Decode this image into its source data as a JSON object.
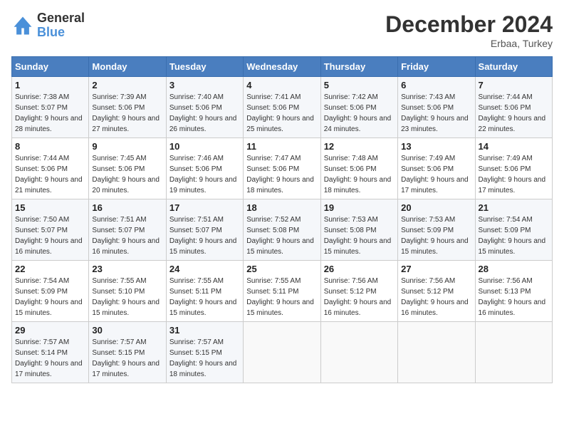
{
  "header": {
    "logo": {
      "line1": "General",
      "line2": "Blue"
    },
    "month": "December 2024",
    "location": "Erbaa, Turkey"
  },
  "weekdays": [
    "Sunday",
    "Monday",
    "Tuesday",
    "Wednesday",
    "Thursday",
    "Friday",
    "Saturday"
  ],
  "weeks": [
    [
      {
        "day": 1,
        "sunrise": "7:38 AM",
        "sunset": "5:07 PM",
        "daylight": "9 hours and 28 minutes."
      },
      {
        "day": 2,
        "sunrise": "7:39 AM",
        "sunset": "5:06 PM",
        "daylight": "9 hours and 27 minutes."
      },
      {
        "day": 3,
        "sunrise": "7:40 AM",
        "sunset": "5:06 PM",
        "daylight": "9 hours and 26 minutes."
      },
      {
        "day": 4,
        "sunrise": "7:41 AM",
        "sunset": "5:06 PM",
        "daylight": "9 hours and 25 minutes."
      },
      {
        "day": 5,
        "sunrise": "7:42 AM",
        "sunset": "5:06 PM",
        "daylight": "9 hours and 24 minutes."
      },
      {
        "day": 6,
        "sunrise": "7:43 AM",
        "sunset": "5:06 PM",
        "daylight": "9 hours and 23 minutes."
      },
      {
        "day": 7,
        "sunrise": "7:44 AM",
        "sunset": "5:06 PM",
        "daylight": "9 hours and 22 minutes."
      }
    ],
    [
      {
        "day": 8,
        "sunrise": "7:44 AM",
        "sunset": "5:06 PM",
        "daylight": "9 hours and 21 minutes."
      },
      {
        "day": 9,
        "sunrise": "7:45 AM",
        "sunset": "5:06 PM",
        "daylight": "9 hours and 20 minutes."
      },
      {
        "day": 10,
        "sunrise": "7:46 AM",
        "sunset": "5:06 PM",
        "daylight": "9 hours and 19 minutes."
      },
      {
        "day": 11,
        "sunrise": "7:47 AM",
        "sunset": "5:06 PM",
        "daylight": "9 hours and 18 minutes."
      },
      {
        "day": 12,
        "sunrise": "7:48 AM",
        "sunset": "5:06 PM",
        "daylight": "9 hours and 18 minutes."
      },
      {
        "day": 13,
        "sunrise": "7:49 AM",
        "sunset": "5:06 PM",
        "daylight": "9 hours and 17 minutes."
      },
      {
        "day": 14,
        "sunrise": "7:49 AM",
        "sunset": "5:06 PM",
        "daylight": "9 hours and 17 minutes."
      }
    ],
    [
      {
        "day": 15,
        "sunrise": "7:50 AM",
        "sunset": "5:07 PM",
        "daylight": "9 hours and 16 minutes."
      },
      {
        "day": 16,
        "sunrise": "7:51 AM",
        "sunset": "5:07 PM",
        "daylight": "9 hours and 16 minutes."
      },
      {
        "day": 17,
        "sunrise": "7:51 AM",
        "sunset": "5:07 PM",
        "daylight": "9 hours and 15 minutes."
      },
      {
        "day": 18,
        "sunrise": "7:52 AM",
        "sunset": "5:08 PM",
        "daylight": "9 hours and 15 minutes."
      },
      {
        "day": 19,
        "sunrise": "7:53 AM",
        "sunset": "5:08 PM",
        "daylight": "9 hours and 15 minutes."
      },
      {
        "day": 20,
        "sunrise": "7:53 AM",
        "sunset": "5:09 PM",
        "daylight": "9 hours and 15 minutes."
      },
      {
        "day": 21,
        "sunrise": "7:54 AM",
        "sunset": "5:09 PM",
        "daylight": "9 hours and 15 minutes."
      }
    ],
    [
      {
        "day": 22,
        "sunrise": "7:54 AM",
        "sunset": "5:09 PM",
        "daylight": "9 hours and 15 minutes."
      },
      {
        "day": 23,
        "sunrise": "7:55 AM",
        "sunset": "5:10 PM",
        "daylight": "9 hours and 15 minutes."
      },
      {
        "day": 24,
        "sunrise": "7:55 AM",
        "sunset": "5:11 PM",
        "daylight": "9 hours and 15 minutes."
      },
      {
        "day": 25,
        "sunrise": "7:55 AM",
        "sunset": "5:11 PM",
        "daylight": "9 hours and 15 minutes."
      },
      {
        "day": 26,
        "sunrise": "7:56 AM",
        "sunset": "5:12 PM",
        "daylight": "9 hours and 16 minutes."
      },
      {
        "day": 27,
        "sunrise": "7:56 AM",
        "sunset": "5:12 PM",
        "daylight": "9 hours and 16 minutes."
      },
      {
        "day": 28,
        "sunrise": "7:56 AM",
        "sunset": "5:13 PM",
        "daylight": "9 hours and 16 minutes."
      }
    ],
    [
      {
        "day": 29,
        "sunrise": "7:57 AM",
        "sunset": "5:14 PM",
        "daylight": "9 hours and 17 minutes."
      },
      {
        "day": 30,
        "sunrise": "7:57 AM",
        "sunset": "5:15 PM",
        "daylight": "9 hours and 17 minutes."
      },
      {
        "day": 31,
        "sunrise": "7:57 AM",
        "sunset": "5:15 PM",
        "daylight": "9 hours and 18 minutes."
      },
      null,
      null,
      null,
      null
    ]
  ]
}
